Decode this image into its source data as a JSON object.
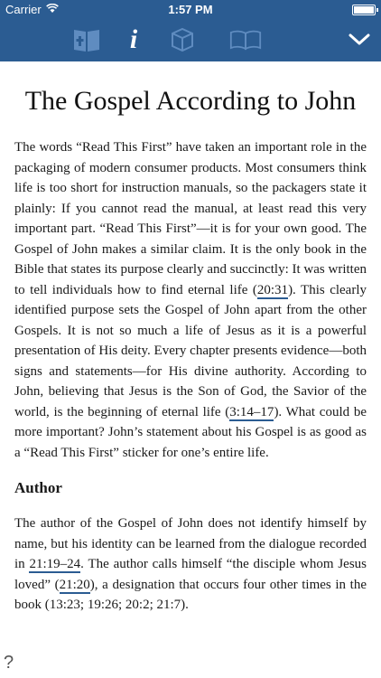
{
  "status": {
    "carrier": "Carrier",
    "time": "1:57 PM"
  },
  "toolbar": {
    "info_label": "i"
  },
  "article": {
    "title": "The Gospel According to John",
    "intro": {
      "t1": "The words “Read This First” have taken an important role in the packaging of modern consumer products. Most consumers think life is too short for instruction manuals, so the packagers state it plainly: If you cannot read the manual, at least read this very important part. “Read This First”—it is for your own good. The Gospel of John makes a similar claim. It is the only book in the Bible that states its purpose clearly and succinctly: It was written to tell individuals how to find eternal life (",
      "r1": "20:31",
      "t2": "). This clearly identified purpose sets the Gospel of John apart from the other Gospels. It is not so much a life of Jesus as it is a powerful presentation of His deity. Every chapter presents evidence—both signs and statements—for His divine authority. According to John, believing that Jesus is the Son of God, the Savior of the world, is the beginning of eternal life (",
      "r2": "3:14–17",
      "t3": "). What could be more important? John’s statement about his Gospel is as good as a “Read This First” sticker for one’s entire life."
    },
    "author_heading": "Author",
    "author": {
      "t1": "The author of the Gospel of John does not identify himself by name, but his identity can be learned from the dialogue recorded in ",
      "r1": "21:19–24",
      "t2": ". The author calls himself “the disciple whom Jesus loved” (",
      "r2": "21:20",
      "t3": "), a designation that occurs four other times in the book (13:23; 19:26; 20:2; 21:7)."
    }
  },
  "help": "?"
}
